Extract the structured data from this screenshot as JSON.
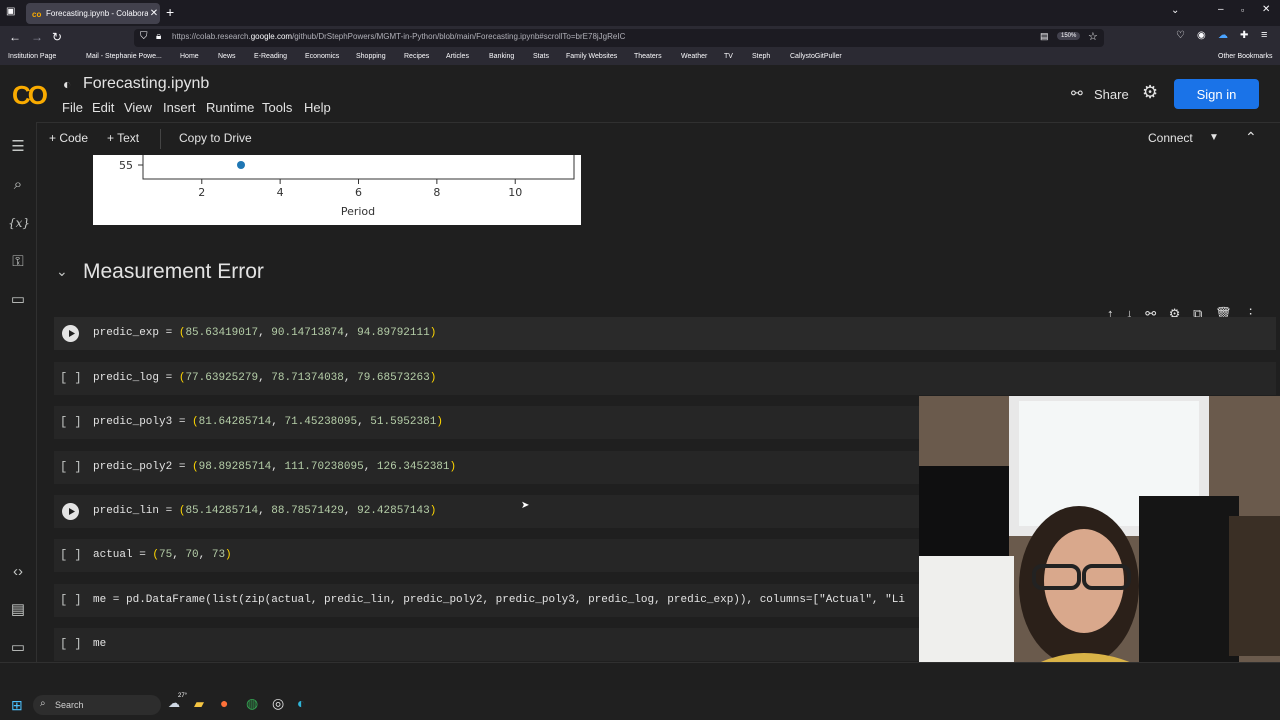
{
  "browser": {
    "tab_title": "Forecasting.ipynb - Colaborato",
    "url_prefix": "https://colab.research.",
    "url_domain": "google.com",
    "url_suffix": "/github/DrStephPowers/MGMT-in-Python/blob/main/Forecasting.ipynb#scrollTo=brE78jJgReIC",
    "zoom": "150%",
    "bookmarks": [
      "Institution Page",
      "Mail - Stephanie Powe...",
      "Home",
      "News",
      "E-Reading",
      "Economics",
      "Shopping",
      "Recipes",
      "Articles",
      "Banking",
      "Stats",
      "Family Websites",
      "Theaters",
      "Weather",
      "TV",
      "Steph",
      "CallystoGitPuller"
    ],
    "other_bookmarks": "Other Bookmarks"
  },
  "colab": {
    "logo": "CO",
    "filename": "Forecasting.ipynb",
    "menu": [
      "File",
      "Edit",
      "View",
      "Insert",
      "Runtime",
      "Tools",
      "Help"
    ],
    "share_label": "Share",
    "signin_label": "Sign in",
    "toolbar": {
      "code_label": "Code",
      "text_label": "Text",
      "copy_label": "Copy to Drive",
      "connect_label": "Connect"
    }
  },
  "plot": {
    "y_tick": "55",
    "x_ticks": [
      "2",
      "4",
      "6",
      "8",
      "10"
    ],
    "xlabel": "Period"
  },
  "section_title": "Measurement Error",
  "cells": [
    {
      "status": "run",
      "var": "predic_exp",
      "values": [
        "85.63419017",
        "90.14713874",
        "94.89792111"
      ]
    },
    {
      "status": "[ ]",
      "var": "predic_log",
      "values": [
        "77.63925279",
        "78.71374038",
        "79.68573263"
      ]
    },
    {
      "status": "[ ]",
      "var": "predic_poly3",
      "values": [
        "81.64285714",
        "71.45238095",
        "51.5952381"
      ]
    },
    {
      "status": "[ ]",
      "var": "predic_poly2",
      "values": [
        "98.89285714",
        "111.70238095",
        "126.3452381"
      ]
    },
    {
      "status": "run",
      "var": "predic_lin",
      "values": [
        "85.14285714",
        "88.78571429",
        "92.42857143"
      ]
    },
    {
      "status": "[ ]",
      "var": "actual",
      "values": [
        "75",
        "70",
        "73"
      ]
    }
  ],
  "df_cell": {
    "status": "[ ]",
    "code": "me = pd.DataFrame(list(zip(actual, predic_lin, predic_poly2, predic_poly3, predic_log, predic_exp)), columns=[\"Actual\", \"Li"
  },
  "last_cell": {
    "status": "[ ]",
    "code": "me"
  },
  "taskbar": {
    "search_label": "Search",
    "temp": "27°"
  }
}
